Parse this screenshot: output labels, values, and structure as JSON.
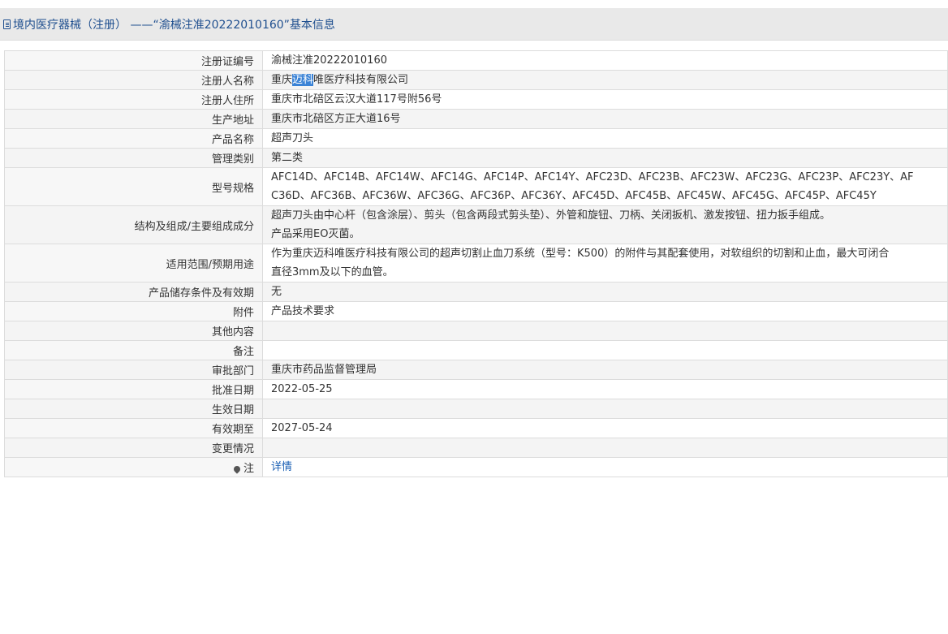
{
  "header": {
    "icon": "document-icon",
    "title": "境内医疗器械（注册） ——“渝械注准20222010160”基本信息"
  },
  "colors": {
    "highlight": "#3b83d6",
    "link": "#1a5fb4",
    "header_bg": "#e9e9e9"
  },
  "rows": {
    "reg_no": {
      "label": "注册证编号",
      "value": "渝械注准20222010160"
    },
    "registrant": {
      "label": "注册人名称",
      "pre": "重庆",
      "hl": "迈科",
      "post": "唯医疗科技有限公司"
    },
    "address": {
      "label": "注册人住所",
      "value": "重庆市北碚区云汉大道117号附56号"
    },
    "prod_addr": {
      "label": "生产地址",
      "value": "重庆市北碚区方正大道16号"
    },
    "product": {
      "label": "产品名称",
      "value": "超声刀头"
    },
    "category": {
      "label": "管理类别",
      "value": "第二类"
    },
    "model": {
      "label": "型号规格",
      "line1": "AFC14D、AFC14B、AFC14W、AFC14G、AFC14P、AFC14Y、AFC23D、AFC23B、AFC23W、AFC23G、AFC23P、AFC23Y、AF",
      "line2": "C36D、AFC36B、AFC36W、AFC36G、AFC36P、AFC36Y、AFC45D、AFC45B、AFC45W、AFC45G、AFC45P、AFC45Y"
    },
    "structure": {
      "label": "结构及组成/主要组成成分",
      "line1": "超声刀头由中心杆（包含涂层）、剪头（包含两段式剪头垫）、外管和旋钮、刀柄、关闭扳机、激发按钮、扭力扳手组成。",
      "line2": "产品采用EO灭菌。"
    },
    "scope": {
      "label": "适用范围/预期用途",
      "line1": "作为重庆迈科唯医疗科技有限公司的超声切割止血刀系统（型号：K500）的附件与其配套使用，对软组织的切割和止血，最大可闭合",
      "line2": "直径3mm及以下的血管。"
    },
    "storage": {
      "label": "产品储存条件及有效期",
      "value": "无"
    },
    "attachment": {
      "label": "附件",
      "value": "产品技术要求"
    },
    "other": {
      "label": "其他内容",
      "value": ""
    },
    "remark": {
      "label": "备注",
      "value": ""
    },
    "dept": {
      "label": "审批部门",
      "value": "重庆市药品监督管理局"
    },
    "approve_date": {
      "label": "批准日期",
      "value": "2022-05-25"
    },
    "effective_date": {
      "label": "生效日期",
      "value": ""
    },
    "valid_until": {
      "label": "有效期至",
      "value": "2027-05-24"
    },
    "change": {
      "label": "变更情况",
      "value": ""
    },
    "note": {
      "label": "注",
      "icon": "pin-icon",
      "link": "详情"
    }
  }
}
